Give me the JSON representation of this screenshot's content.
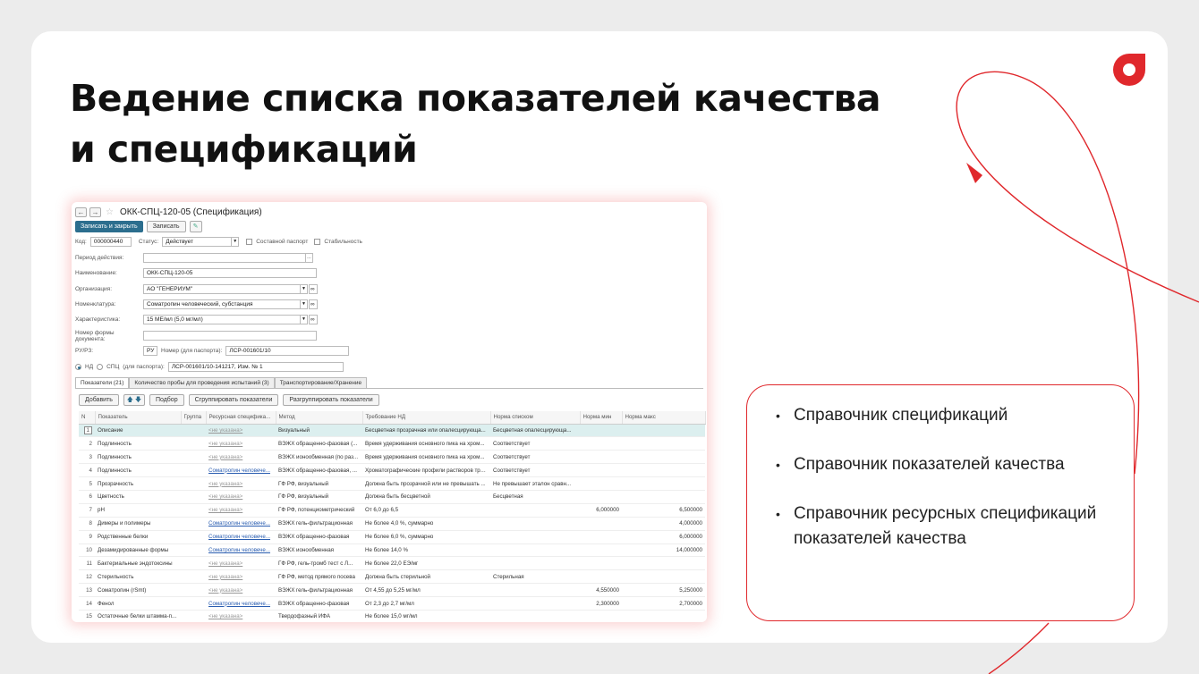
{
  "slide": {
    "title_line1": "Ведение списка показателей качества",
    "title_line2": "и спецификаций"
  },
  "colors": {
    "accent": "#e0282c",
    "primary_button": "#2c6e8e",
    "selected_row": "#dcefef"
  },
  "app": {
    "doc_title": "ОКК-СПЦ-120-05 (Спецификация)",
    "back_icon": "arrow-left-icon",
    "forward_icon": "arrow-right-icon",
    "star_icon": "star-icon",
    "toolbar": {
      "save_close": "Записать и закрыть",
      "save": "Записать"
    },
    "form": {
      "code_label": "Код:",
      "code_value": "000000440",
      "status_label": "Статус:",
      "status_value": "Действует",
      "composite_label": "Составной паспорт",
      "stability_label": "Стабильность",
      "period_label": "Период действия:",
      "period_value": "",
      "name_label": "Наименование:",
      "name_value": "ОКК-СПЦ-120-05",
      "org_label": "Организация:",
      "org_value": "АО \"ГЕНЕРИУМ\"",
      "nom_label": "Номенклатура:",
      "nom_value": "Соматропин человеческий, субстанция",
      "char_label": "Характеристика:",
      "char_value": "15 МЕ/мл (5,0 мг/мл)",
      "form_no_label": "Номер формы документа:",
      "form_no_value": "",
      "ru_label": "РУ/РЗ:",
      "ru_value": "РУ",
      "passport_label": "Номер (для паспорта):",
      "passport_value": "ЛСР-001601/10",
      "nd_label": "НД",
      "spc_label": "СПЦ",
      "for_passport_label": "(для паспорта):",
      "nd_value": "ЛСР-001601/10-141217, Изм. № 1"
    },
    "tabs": [
      "Показатели (21)",
      "Количество пробы для проведения испытаний (3)",
      "Транспортирование/Хранение"
    ],
    "table_toolbar": {
      "add": "Добавить",
      "pick": "Подбор",
      "group": "Сгруппировать показатели",
      "ungroup": "Разгруппировать показатели"
    },
    "columns": [
      "N",
      "Показатель",
      "Группа",
      "Ресурсная специфика...",
      "Метод",
      "Требование НД",
      "Норма списком",
      "Норма мин",
      "Норма макс"
    ],
    "rows": [
      {
        "n": "1",
        "name": "Описание",
        "group": "",
        "res": "<не указана>",
        "method": "Визуальный",
        "req": "Бесцветная прозрачная или опалесцирующа...",
        "list": "Бесцветная опалесцирующа...",
        "min": "",
        "max": ""
      },
      {
        "n": "2",
        "name": "Подлинность",
        "group": "",
        "res": "<не указана>",
        "method": "ВЭЖХ обращенно-фазовая (...",
        "req": "Время удерживания основного пика на хром...",
        "list": "Соответствует",
        "min": "",
        "max": ""
      },
      {
        "n": "3",
        "name": "Подлинность",
        "group": "",
        "res": "<не указана>",
        "method": "ВЭЖХ ионообменная (по раз...",
        "req": "Время удерживания основного пика на хром...",
        "list": "Соответствует",
        "min": "",
        "max": ""
      },
      {
        "n": "4",
        "name": "Подлинность",
        "group": "",
        "res": "Соматропин человече...",
        "method": "ВЭЖХ обращенно-фазовая, ...",
        "req": "Хроматографические профили растворов три...",
        "list": "Соответствует",
        "min": "",
        "max": ""
      },
      {
        "n": "5",
        "name": "Прозрачность",
        "group": "",
        "res": "<не указана>",
        "method": "ГФ РФ, визуальный",
        "req": "Должна быть прозрачной или не превышать ...",
        "list": "Не превышает эталон сравн...",
        "min": "",
        "max": ""
      },
      {
        "n": "6",
        "name": "Цветность",
        "group": "",
        "res": "<не указана>",
        "method": "ГФ РФ, визуальный",
        "req": "Должна быть бесцветной",
        "list": "Бесцветная",
        "min": "",
        "max": ""
      },
      {
        "n": "7",
        "name": "pH",
        "group": "",
        "res": "<не указана>",
        "method": "ГФ РФ, потенциометрический",
        "req": "От 6,0 до 6,5",
        "list": "",
        "min": "6,000000",
        "max": "6,500000"
      },
      {
        "n": "8",
        "name": "Димеры и полимеры",
        "group": "",
        "res": "Соматропин человече...",
        "method": "ВЭЖХ гель-фильтрационная",
        "req": "Не более 4,0 %, суммарно",
        "list": "",
        "min": "",
        "max": "4,000000"
      },
      {
        "n": "9",
        "name": "Родственные белки",
        "group": "",
        "res": "Соматропин человече...",
        "method": "ВЭЖХ обращенно-фазовая",
        "req": "Не более 6,0 %, суммарно",
        "list": "",
        "min": "",
        "max": "6,000000"
      },
      {
        "n": "10",
        "name": "Дезамидированные формы",
        "group": "",
        "res": "Соматропин человече...",
        "method": "ВЭЖХ ионообменная",
        "req": "Не более 14,0 %",
        "list": "",
        "min": "",
        "max": "14,000000"
      },
      {
        "n": "11",
        "name": "Бактериальные эндотоксины",
        "group": "",
        "res": "<не указана>",
        "method": "ГФ РФ, гель-тромб тест с Л...",
        "req": "Не более 22,0 ЕЭ/мг",
        "list": "",
        "min": "",
        "max": ""
      },
      {
        "n": "12",
        "name": "Стерильность",
        "group": "",
        "res": "<не указана>",
        "method": "ГФ РФ, метод прямого посева",
        "req": "Должна быть стерильной",
        "list": "Стерильная",
        "min": "",
        "max": ""
      },
      {
        "n": "13",
        "name": "Соматропин (rSmt)",
        "group": "",
        "res": "<не указана>",
        "method": "ВЭЖХ гель-фильтрационная",
        "req": "От 4,55 до 5,25 мг/мл",
        "list": "",
        "min": "4,550000",
        "max": "5,250000"
      },
      {
        "n": "14",
        "name": "Фенол",
        "group": "",
        "res": "Соматропин человече...",
        "method": "ВЭЖХ обращенно-фазовая",
        "req": "От 2,3 до 2,7 мг/мл",
        "list": "",
        "min": "2,300000",
        "max": "2,700000"
      },
      {
        "n": "15",
        "name": "Остаточные белки штамма-п...",
        "group": "",
        "res": "<не указана>",
        "method": "Твердофазный ИФА",
        "req": "Не более 15,0 мг/мл",
        "list": "",
        "min": "",
        "max": ""
      }
    ]
  },
  "card": {
    "items": [
      "Справочник спецификаций",
      "Справочник показателей качества",
      "Справочник ресурсных спецификаций показателей качества"
    ]
  }
}
